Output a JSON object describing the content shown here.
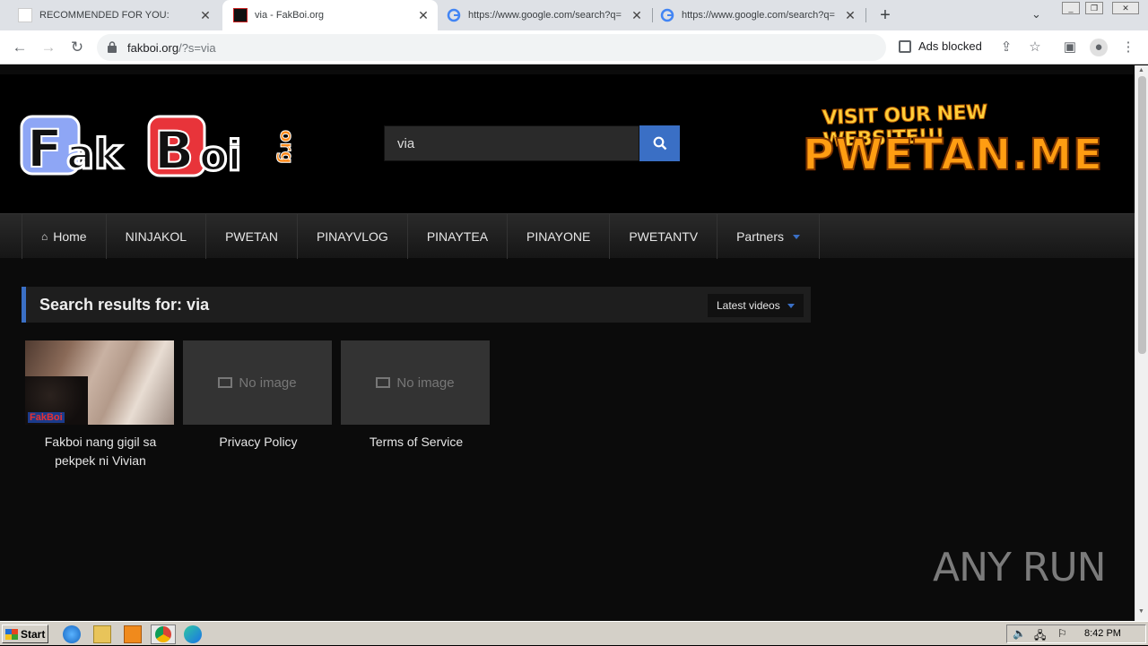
{
  "browser": {
    "tabs": [
      {
        "title": "RECOMMENDED FOR YOU:",
        "active": false
      },
      {
        "title": "via - FakBoi.org",
        "active": true
      },
      {
        "title": "https://www.google.com/search?q=",
        "active": false
      },
      {
        "title": "https://www.google.com/search?q=",
        "active": false
      }
    ],
    "url_host": "fakboi.org",
    "url_path": "/?s=via",
    "ads_blocked": "Ads blocked"
  },
  "site": {
    "logo_text": "FakBoi.org",
    "search_value": "via",
    "banner_top": "VISIT OUR NEW WEBSITE!!!",
    "banner_big": "PWETAN.ME",
    "nav": [
      "Home",
      "NINJAKOL",
      "PWETAN",
      "PINAYVLOG",
      "PINAYTEA",
      "PINAYONE",
      "PWETANTV",
      "Partners"
    ],
    "results_title": "Search results for: via",
    "sort_label": "Latest videos",
    "no_image": "No image",
    "cards": [
      {
        "caption": "Fakboi nang gigil sa pekpek ni Vivian",
        "thumb_watermark": "FakBoi"
      },
      {
        "caption": "Privacy Policy"
      },
      {
        "caption": "Terms of Service"
      }
    ]
  },
  "watermark": "ANY RUN",
  "taskbar": {
    "start": "Start",
    "clock": "8:42 PM"
  },
  "colors": {
    "accent": "#3a6fc5",
    "banner_orange": "#ff9d12"
  }
}
